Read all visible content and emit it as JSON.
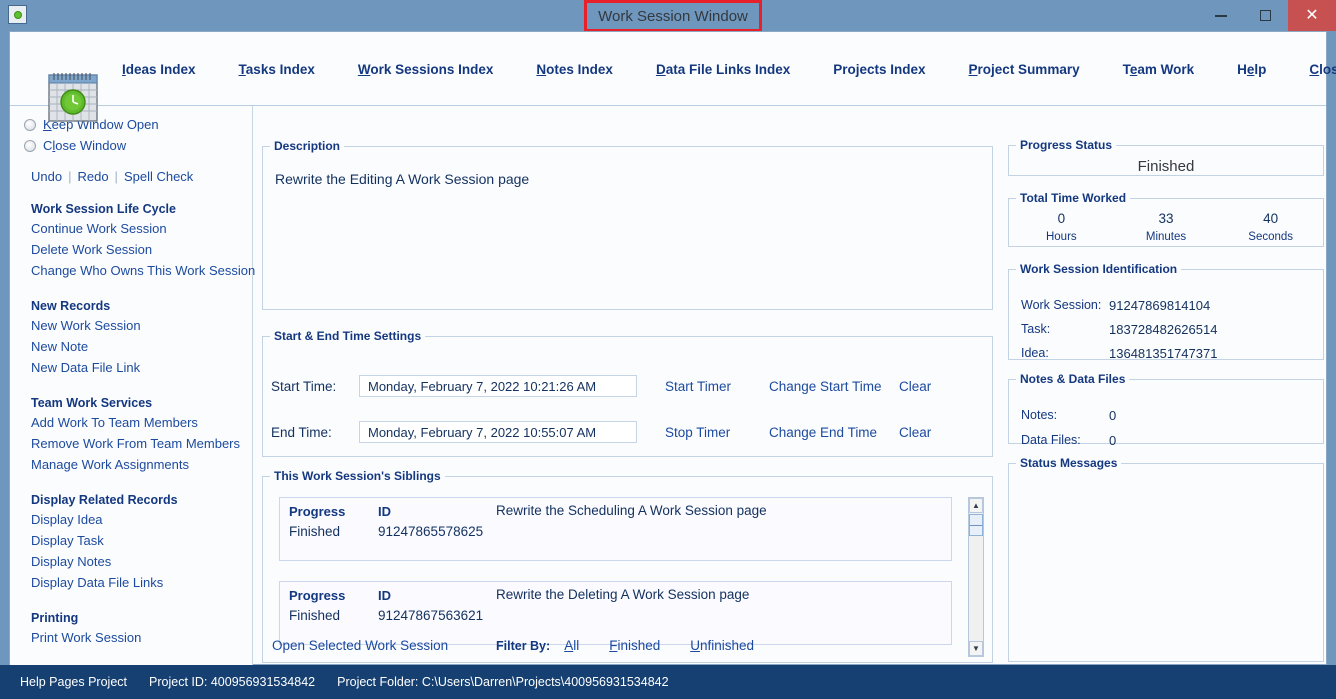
{
  "titlebar": {
    "title": "Work Session Window",
    "icon": "calendar-clock-icon",
    "minimize_label": "Minimize",
    "maximize_label": "Maximize",
    "close_label": "✕",
    "highlight_color": "#e8202a",
    "bar_color": "#6f96bc"
  },
  "nav": {
    "app_icon": "calendar-clock-icon",
    "items": [
      {
        "accel": "I",
        "rest": "deas Index"
      },
      {
        "accel": "T",
        "rest": "asks Index"
      },
      {
        "accel": "W",
        "rest": "ork Sessions Index"
      },
      {
        "accel": "N",
        "rest": "otes Index"
      },
      {
        "accel": "D",
        "rest": "ata File Links Index"
      },
      {
        "accel": "P",
        "rest": "rojects Index"
      },
      {
        "accel": "P",
        "rest": "roject Summary",
        "prefix": ""
      },
      {
        "accel": "e",
        "rest": "am Work",
        "prefix": "T"
      },
      {
        "accel": "e",
        "rest": "lp",
        "prefix": "H"
      },
      {
        "accel": "C",
        "rest": "lose Program"
      }
    ]
  },
  "sidebar": {
    "radios": [
      {
        "prefix": "",
        "accel": "K",
        "rest": "eep Window Open"
      },
      {
        "prefix": "C",
        "accel": "l",
        "rest": "ose Window"
      }
    ],
    "edit_actions": [
      "Undo",
      "Redo",
      "Spell Check"
    ],
    "groups": [
      {
        "title": "Work Session Life Cycle",
        "links": [
          "Continue Work Session",
          "Delete Work Session",
          "Change Who Owns This Work Session"
        ]
      },
      {
        "title": "New Records",
        "links": [
          "New Work Session",
          "New Note",
          "New Data File Link"
        ]
      },
      {
        "title": "Team Work Services",
        "links": [
          "Add Work To Team Members",
          "Remove Work From Team Members",
          "Manage Work Assignments"
        ]
      },
      {
        "title": "Display Related Records",
        "links": [
          "Display Idea",
          "Display Task",
          "Display Notes",
          "Display Data File Links"
        ]
      },
      {
        "title": "Printing",
        "links": [
          "Print Work Session"
        ]
      }
    ]
  },
  "description": {
    "legend": "Description",
    "text": "Rewrite the Editing A Work Session page"
  },
  "time_settings": {
    "legend": "Start & End Time Settings",
    "rows": [
      {
        "label": "Start Time:",
        "value": "Monday, February 7, 2022  10:21:26 AM",
        "action1": "Start Timer",
        "action2": "Change Start Time",
        "action3": "Clear"
      },
      {
        "label": "End Time:",
        "value": "Monday, February 7, 2022  10:55:07 AM",
        "action1": "Stop Timer",
        "action2": "Change End Time",
        "action3": "Clear"
      }
    ]
  },
  "siblings": {
    "legend": "This Work Session's Siblings",
    "col_progress": "Progress",
    "col_id": "ID",
    "rows": [
      {
        "progress": "Finished",
        "id": "91247865578625",
        "description": "Rewrite the Scheduling A Work Session page"
      },
      {
        "progress": "Finished",
        "id": "91247867563621",
        "description": "Rewrite the Deleting A Work Session page"
      }
    ],
    "open_link": "Open Selected Work Session",
    "filter_label": "Filter By:",
    "filters": [
      {
        "accel": "A",
        "rest": "ll"
      },
      {
        "accel": "F",
        "rest": "inished"
      },
      {
        "accel": "U",
        "rest": "nfinished"
      }
    ]
  },
  "progress_status": {
    "legend": "Progress Status",
    "value": "Finished"
  },
  "total_time_worked": {
    "legend": "Total Time Worked",
    "cols": [
      {
        "value": "0",
        "label": "Hours"
      },
      {
        "value": "33",
        "label": "Minutes"
      },
      {
        "value": "40",
        "label": "Seconds"
      }
    ]
  },
  "work_session_identification": {
    "legend": "Work Session Identification",
    "fields": [
      {
        "key": "Work Session:",
        "value": "91247869814104"
      },
      {
        "key": "Task:",
        "value": "183728482626514"
      },
      {
        "key": "Idea:",
        "value": "136481351747371"
      }
    ]
  },
  "notes_data_files": {
    "legend": "Notes & Data Files",
    "fields": [
      {
        "key": "Notes:",
        "value": "0"
      },
      {
        "key": "Data Files:",
        "value": "0"
      }
    ]
  },
  "status_messages": {
    "legend": "Status Messages",
    "text": ""
  },
  "statusbar": {
    "project_name": "Help Pages Project",
    "project_id_label": "Project ID:  400956931534842",
    "project_folder_label": "Project Folder: C:\\Users\\Darren\\Projects\\400956931534842"
  }
}
